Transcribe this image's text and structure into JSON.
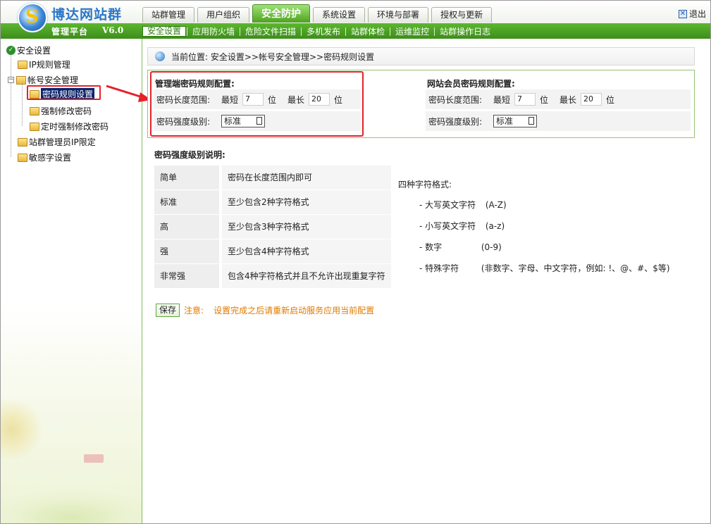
{
  "app": {
    "brand": "博达网站群",
    "platform": "管理平台",
    "version": "V6.0",
    "logout": "退出"
  },
  "top_tabs": [
    {
      "label": "站群管理"
    },
    {
      "label": "用户组织"
    },
    {
      "label": "安全防护",
      "active": true
    },
    {
      "label": "系统设置"
    },
    {
      "label": "环境与部署"
    },
    {
      "label": "授权与更新"
    }
  ],
  "sub_nav": [
    {
      "label": "安全设置",
      "active": true
    },
    {
      "label": "应用防火墙"
    },
    {
      "label": "危险文件扫描"
    },
    {
      "label": "多机发布"
    },
    {
      "label": "站群体检"
    },
    {
      "label": "运维监控"
    },
    {
      "label": "站群操作日志"
    }
  ],
  "sidebar": {
    "root": "安全设置",
    "items": [
      {
        "label": "IP规则管理"
      },
      {
        "label": "帐号安全管理"
      },
      {
        "label": "密码规则设置"
      },
      {
        "label": "强制修改密码"
      },
      {
        "label": "定时强制修改密码"
      },
      {
        "label": "站群管理员IP限定"
      },
      {
        "label": "敏感字设置"
      }
    ]
  },
  "breadcrumb": "当前位置: 安全设置>>帐号安全管理>>密码规则设置",
  "admin_config": {
    "title": "管理端密码规则配置:",
    "length_label": "密码长度范围:",
    "min_label": "最短",
    "min_value": "7",
    "max_label": "最长",
    "max_value": "20",
    "unit": "位",
    "strength_label": "密码强度级别:",
    "strength_value": "标准"
  },
  "member_config": {
    "title": "网站会员密码规则配置:",
    "length_label": "密码长度范围:",
    "min_label": "最短",
    "min_value": "7",
    "max_label": "最长",
    "max_value": "20",
    "unit": "位",
    "strength_label": "密码强度级别:",
    "strength_value": "标准"
  },
  "explain": {
    "title": "密码强度级别说明:",
    "rows": [
      {
        "level": "简单",
        "desc": "密码在长度范围内即可"
      },
      {
        "level": "标准",
        "desc": "至少包含2种字符格式"
      },
      {
        "level": "高",
        "desc": "至少包含3种字符格式"
      },
      {
        "level": "强",
        "desc": "至少包含4种字符格式"
      },
      {
        "level": "非常强",
        "desc": "包含4种字符格式并且不允许出现重复字符"
      }
    ]
  },
  "formats": {
    "title": "四种字符格式:",
    "items": [
      {
        "name": "- 大写英文字符",
        "example": "(A-Z)"
      },
      {
        "name": "- 小写英文字符",
        "example": "(a-z)"
      },
      {
        "name": "- 数字",
        "example": "(0-9)"
      },
      {
        "name": "- 特殊字符",
        "example": "(非数字、字母、中文字符，例如: !、@、#、$等)"
      }
    ]
  },
  "save": {
    "button": "保存",
    "note_label": "注意:",
    "note_text": "设置完成之后请重新启动服务应用当前配置"
  },
  "colors": {
    "accent_green": "#4ea31f",
    "highlight_red": "#e4222a",
    "note_orange": "#e07a00"
  }
}
